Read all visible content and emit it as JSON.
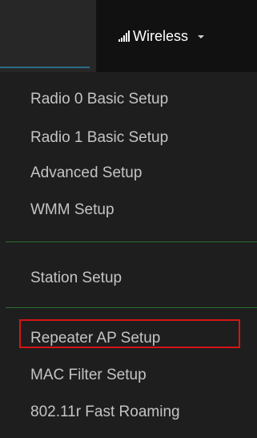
{
  "navbar": {
    "wireless_label": "Wireless"
  },
  "menu": {
    "items": [
      {
        "label": "Radio 0 Basic Setup"
      },
      {
        "label": "Radio 1 Basic Setup"
      },
      {
        "label": "Advanced Setup"
      },
      {
        "label": "WMM Setup"
      },
      {
        "label": "Station Setup"
      },
      {
        "label": "Repeater AP Setup"
      },
      {
        "label": "MAC Filter Setup"
      },
      {
        "label": "802.11r Fast Roaming"
      }
    ]
  },
  "colors": {
    "divider": "#2e6e2b",
    "highlight_border": "#d51515",
    "menu_text": "#c4c4c4",
    "active_tab_underline": "#2a6d8a"
  }
}
